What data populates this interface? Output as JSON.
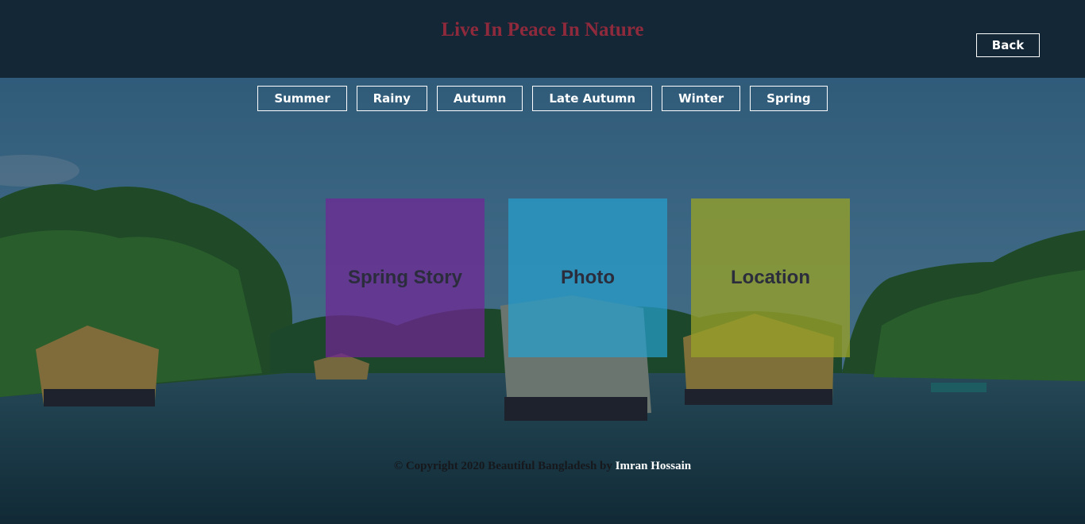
{
  "header": {
    "title": "Live In Peace In Nature",
    "back_label": "Back"
  },
  "nav": {
    "items": [
      "Summer",
      "Rainy",
      "Autumn",
      "Late Autumn",
      "Winter",
      "Spring"
    ]
  },
  "cards": {
    "story": "Spring Story",
    "photo": "Photo",
    "location": "Location"
  },
  "footer": {
    "copyright": "© Copyright 2020 Beautiful Bangladesh by",
    "author": "Imran Hossain"
  },
  "colors": {
    "title": "#8e2a3c",
    "header_bg": "#122332",
    "card_story": "#7026a0",
    "card_photo": "#26a0cd",
    "card_location": "#96a028"
  }
}
